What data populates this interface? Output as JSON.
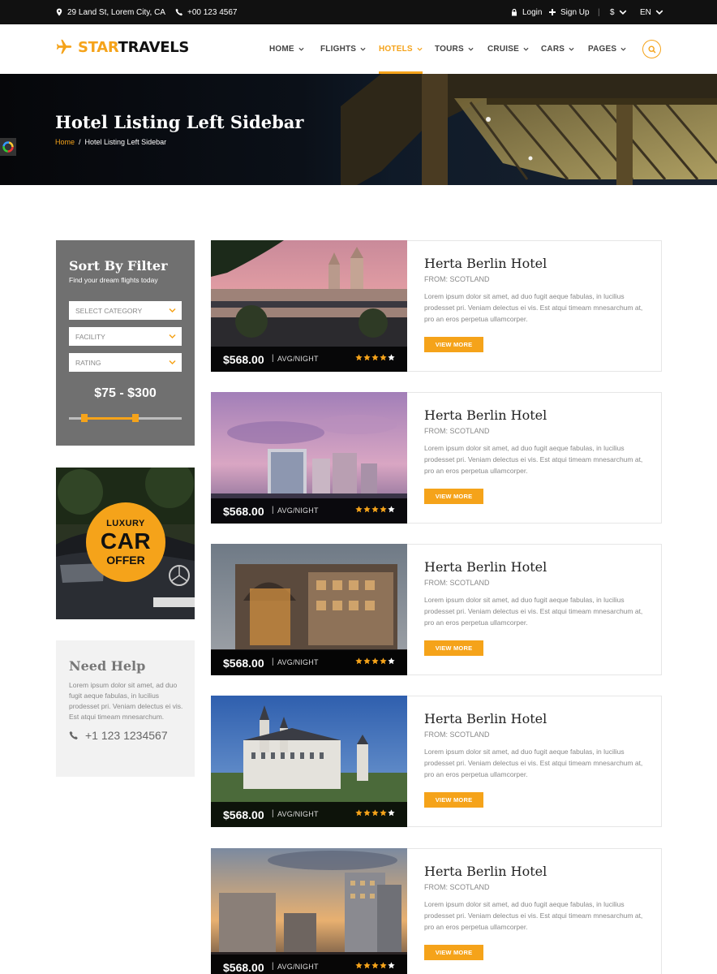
{
  "topbar": {
    "address": "29 Land St, Lorem City, CA",
    "phone": "+00 123 4567",
    "login": "Login",
    "signup": "Sign Up",
    "currency": "$",
    "language": "EN"
  },
  "header": {
    "logo_part1": "STAR",
    "logo_part2": "TRAVELS",
    "nav": [
      {
        "label": "HOME"
      },
      {
        "label": "FLIGHTS"
      },
      {
        "label": "HOTELS",
        "active": true
      },
      {
        "label": "TOURS"
      },
      {
        "label": "CRUISE"
      },
      {
        "label": "CARS"
      },
      {
        "label": "PAGES"
      }
    ]
  },
  "banner": {
    "title": "Hotel Listing Left Sidebar",
    "breadcrumb_home": "Home",
    "breadcrumb_sep": "/",
    "breadcrumb_current": "Hotel Listing Left Sidebar"
  },
  "filter": {
    "title": "Sort By Filter",
    "subtitle": "Find your dream flights today",
    "category": "SELECT CATEGORY",
    "facility": "FACILITY",
    "rating": "RATING",
    "price_range": "$75 - $300",
    "slider_min_fraction": 0.14,
    "slider_max_fraction": 0.59
  },
  "ad": {
    "line1": "LUXURY",
    "line2": "CAR",
    "line3": "OFFER"
  },
  "help": {
    "title": "Need Help",
    "text": "Lorem ipsum dolor sit amet, ad duo fugit aeque fabulas, in lucilius prodesset pri. Veniam delectus ei vis. Est atqui timeam mnesarchum.",
    "phone": "+1 123 1234567"
  },
  "hotels": [
    {
      "name": "Herta Berlin Hotel",
      "from": "FROM: SCOTLAND",
      "desc": "Lorem ipsum dolor sit amet, ad duo fugit aeque fabulas, in lucilius prodesset pri. Veniam delectus ei vis. Est atqui timeam mnesarchum at, pro an eros perpetua ullamcorper.",
      "price": "$568.00",
      "sep": "|",
      "per": "AVG/NIGHT",
      "stars": 4,
      "button": "VIEW MORE"
    },
    {
      "name": "Herta Berlin Hotel",
      "from": "FROM: SCOTLAND",
      "desc": "Lorem ipsum dolor sit amet, ad duo fugit aeque fabulas, in lucilius prodesset pri. Veniam delectus ei vis. Est atqui timeam mnesarchum at, pro an eros perpetua ullamcorper.",
      "price": "$568.00",
      "sep": "|",
      "per": "AVG/NIGHT",
      "stars": 4,
      "button": "VIEW MORE"
    },
    {
      "name": "Herta Berlin Hotel",
      "from": "FROM: SCOTLAND",
      "desc": "Lorem ipsum dolor sit amet, ad duo fugit aeque fabulas, in lucilius prodesset pri. Veniam delectus ei vis. Est atqui timeam mnesarchum at, pro an eros perpetua ullamcorper.",
      "price": "$568.00",
      "sep": "|",
      "per": "AVG/NIGHT",
      "stars": 4,
      "button": "VIEW MORE"
    },
    {
      "name": "Herta Berlin Hotel",
      "from": "FROM: SCOTLAND",
      "desc": "Lorem ipsum dolor sit amet, ad duo fugit aeque fabulas, in lucilius prodesset pri. Veniam delectus ei vis. Est atqui timeam mnesarchum at, pro an eros perpetua ullamcorper.",
      "price": "$568.00",
      "sep": "|",
      "per": "AVG/NIGHT",
      "stars": 4,
      "button": "VIEW MORE"
    },
    {
      "name": "Herta Berlin Hotel",
      "from": "FROM: SCOTLAND",
      "desc": "Lorem ipsum dolor sit amet, ad duo fugit aeque fabulas, in lucilius prodesset pri. Veniam delectus ei vis. Est atqui timeam mnesarchum at, pro an eros perpetua ullamcorper.",
      "price": "$568.00",
      "sep": "|",
      "per": "AVG/NIGHT",
      "stars": 4,
      "button": "VIEW MORE"
    }
  ],
  "colors": {
    "accent": "#f5a31a",
    "topbar": "#111111",
    "filter_panel": "#707070",
    "help_panel": "#f2f2f2"
  }
}
